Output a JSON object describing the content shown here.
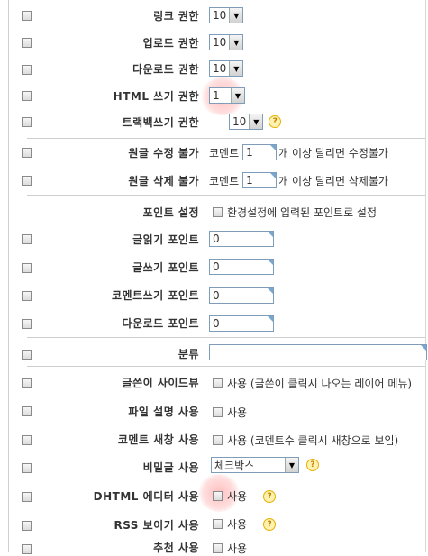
{
  "rows": {
    "link": {
      "label": "링크 권한",
      "select": "10"
    },
    "upload": {
      "label": "업로드 권한",
      "select": "10"
    },
    "download": {
      "label": "다운로드 권한",
      "select": "10"
    },
    "html": {
      "label": "HTML 쓰기 권한",
      "select": "1"
    },
    "trackback": {
      "label": "트랙백쓰기 권한",
      "select": "10"
    },
    "no_edit": {
      "label": "원글 수정 불가",
      "prefix": "코멘트",
      "value": "1",
      "suffix": "개 이상 달리면 수정불가"
    },
    "no_delete": {
      "label": "원글 삭제 불가",
      "prefix": "코멘트",
      "value": "1",
      "suffix": "개 이상 달리면 삭제불가"
    },
    "point_set": {
      "label": "포인트 설정",
      "check_label": "환경설정에 입력된 포인트로 설정"
    },
    "read_point": {
      "label": "글읽기 포인트",
      "value": "0"
    },
    "write_point": {
      "label": "글쓰기 포인트",
      "value": "0"
    },
    "comment_point": {
      "label": "코멘트쓰기 포인트",
      "value": "0"
    },
    "down_point": {
      "label": "다운로드 포인트",
      "value": "0"
    },
    "category": {
      "label": "분류",
      "value": ""
    },
    "sideview": {
      "label": "글쓴이 사이드뷰",
      "check_label": "사용 (글쓴이 클릭시 나오는 레이어 메뉴)"
    },
    "file_desc": {
      "label": "파일 설명 사용",
      "check_label": "사용"
    },
    "comment_win": {
      "label": "코멘트 새창 사용",
      "check_label": "사용 (코멘트수 클릭시 새창으로 보임)"
    },
    "secret": {
      "label": "비밀글 사용",
      "select": "체크박스"
    },
    "dhtml": {
      "label": "DHTML 에디터 사용",
      "check_label": "사용"
    },
    "rss": {
      "label": "RSS 보이기 사용",
      "check_label": "사용"
    },
    "recommend": {
      "label": "추천 사용",
      "check_label": "사용"
    }
  },
  "icons": {
    "help": "help-icon",
    "dropdown": "chevron-down-icon"
  }
}
